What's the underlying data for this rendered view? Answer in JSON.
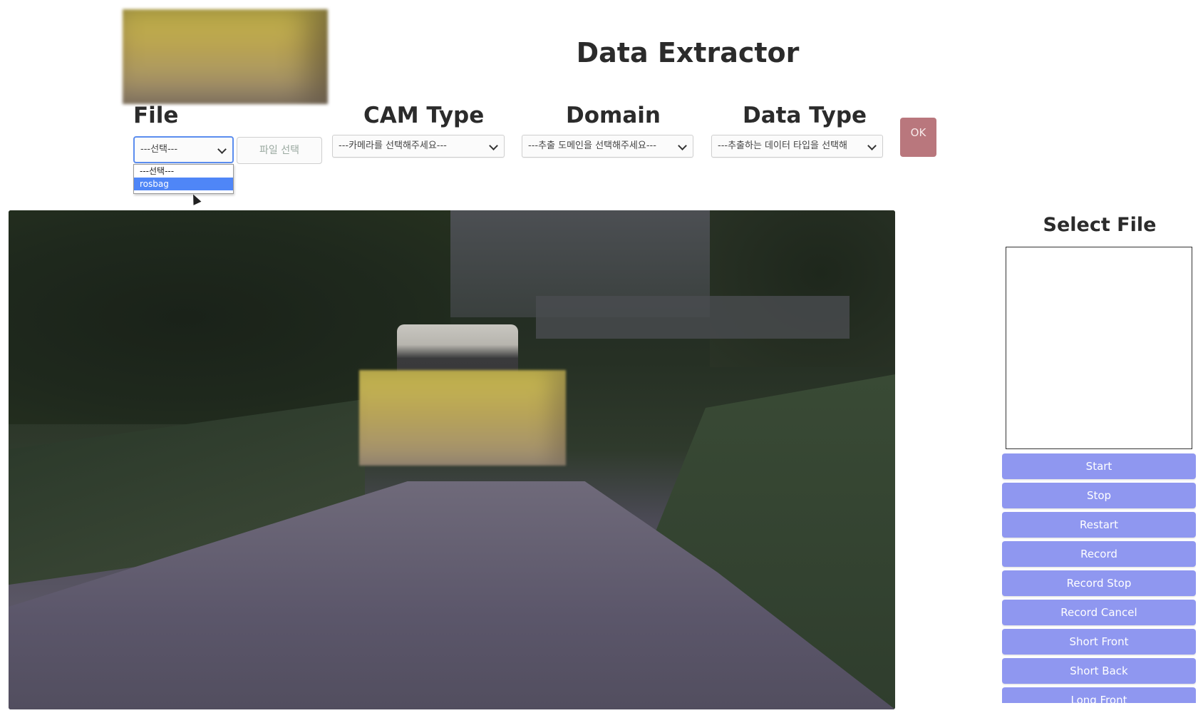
{
  "app": {
    "title": "Data Extractor"
  },
  "selectors": {
    "file": {
      "label": "File",
      "value": "---선택---",
      "file_button": "파일 선택"
    },
    "cam_type": {
      "label": "CAM Type",
      "value": "---카메라를 선택해주세요---"
    },
    "domain": {
      "label": "Domain",
      "value": "---추출 도메인을 선택해주세요---"
    },
    "data_type": {
      "label": "Data Type",
      "value": "---추출하는 데이터 타입을 선택해"
    }
  },
  "file_dropdown": {
    "options": [
      "---선택---",
      "rosbag"
    ],
    "highlighted_index": 1
  },
  "ok_button": {
    "label": "OK",
    "color": "#b9777d"
  },
  "sidebar": {
    "title": "Select File",
    "buttons": [
      "Start",
      "Stop",
      "Restart",
      "Record",
      "Record Stop",
      "Record Cancel",
      "Short Front",
      "Short Back",
      "Long Front"
    ],
    "button_color": "#8f97f0"
  },
  "icons": {
    "select_chevron": "chevron-down-icon",
    "cursor": "mouse-pointer-icon"
  }
}
